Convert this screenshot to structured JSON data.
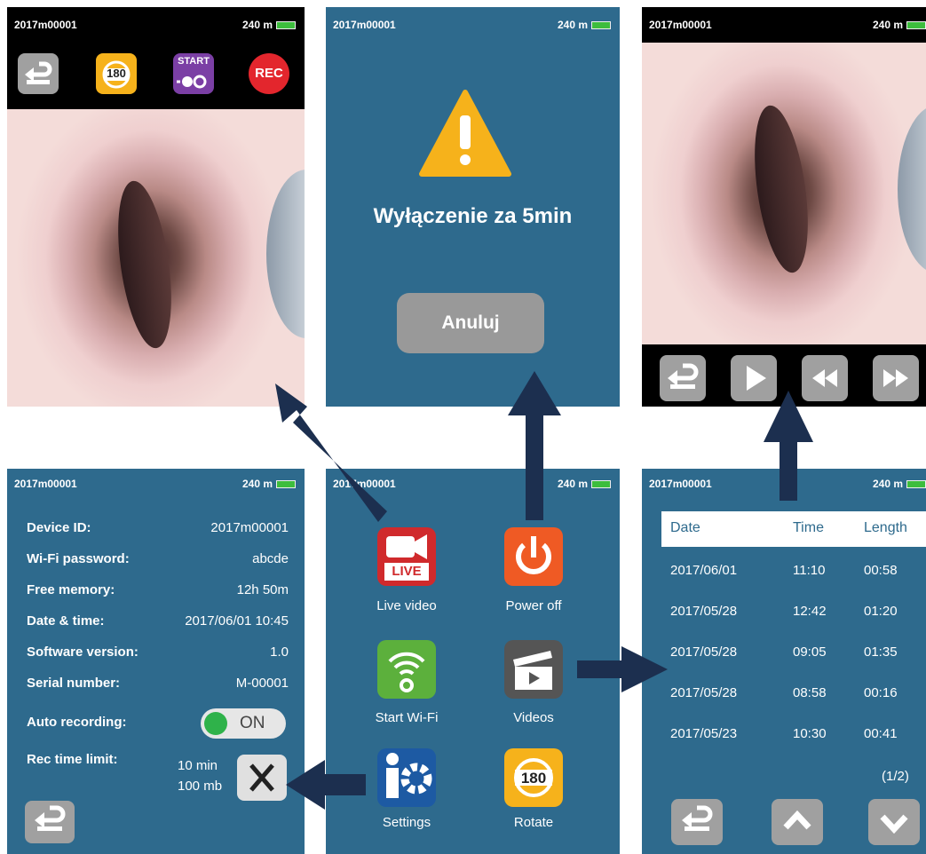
{
  "device_id": "2017m00001",
  "memory": "240 m",
  "live_screen": {
    "rotate_label": "180",
    "start_label": "START",
    "rec_label": "REC"
  },
  "poweroff_screen": {
    "message": "Wyłączenie za 5min",
    "cancel_label": "Anuluj"
  },
  "settings_screen": {
    "rows": [
      {
        "label": "Device ID:",
        "value": "2017m00001"
      },
      {
        "label": "Wi-Fi password:",
        "value": "abcde"
      },
      {
        "label": "Free memory:",
        "value": "12h 50m"
      },
      {
        "label": "Date & time:",
        "value": "2017/06/01 10:45"
      },
      {
        "label": "Software version:",
        "value": "1.0"
      },
      {
        "label": "Serial number:",
        "value": "M-00001"
      }
    ],
    "auto_recording_label": "Auto recording:",
    "auto_recording_value": "ON",
    "rec_limit_label": "Rec time limit:",
    "rec_limit_time": "10 min",
    "rec_limit_size": "100 mb"
  },
  "menu": {
    "live_badge": "LIVE",
    "rotate_badge": "180",
    "items": [
      {
        "label": "Live video"
      },
      {
        "label": "Power off"
      },
      {
        "label": "Start Wi-Fi"
      },
      {
        "label": "Videos"
      },
      {
        "label": "Settings"
      },
      {
        "label": "Rotate"
      }
    ]
  },
  "videos_screen": {
    "headers": {
      "date": "Date",
      "time": "Time",
      "length": "Length"
    },
    "rows": [
      {
        "date": "2017/06/01",
        "time": "11:10",
        "length": "00:58"
      },
      {
        "date": "2017/05/28",
        "time": "12:42",
        "length": "01:20"
      },
      {
        "date": "2017/05/28",
        "time": "09:05",
        "length": "01:35"
      },
      {
        "date": "2017/05/28",
        "time": "08:58",
        "length": "00:16"
      },
      {
        "date": "2017/05/23",
        "time": "10:30",
        "length": "00:41"
      }
    ],
    "page": "(1/2)"
  },
  "colors": {
    "screen_bg": "#2e6a8d",
    "arrow": "#1c2f4f",
    "battery": "#3dbd3d",
    "warning": "#f6b21b"
  }
}
